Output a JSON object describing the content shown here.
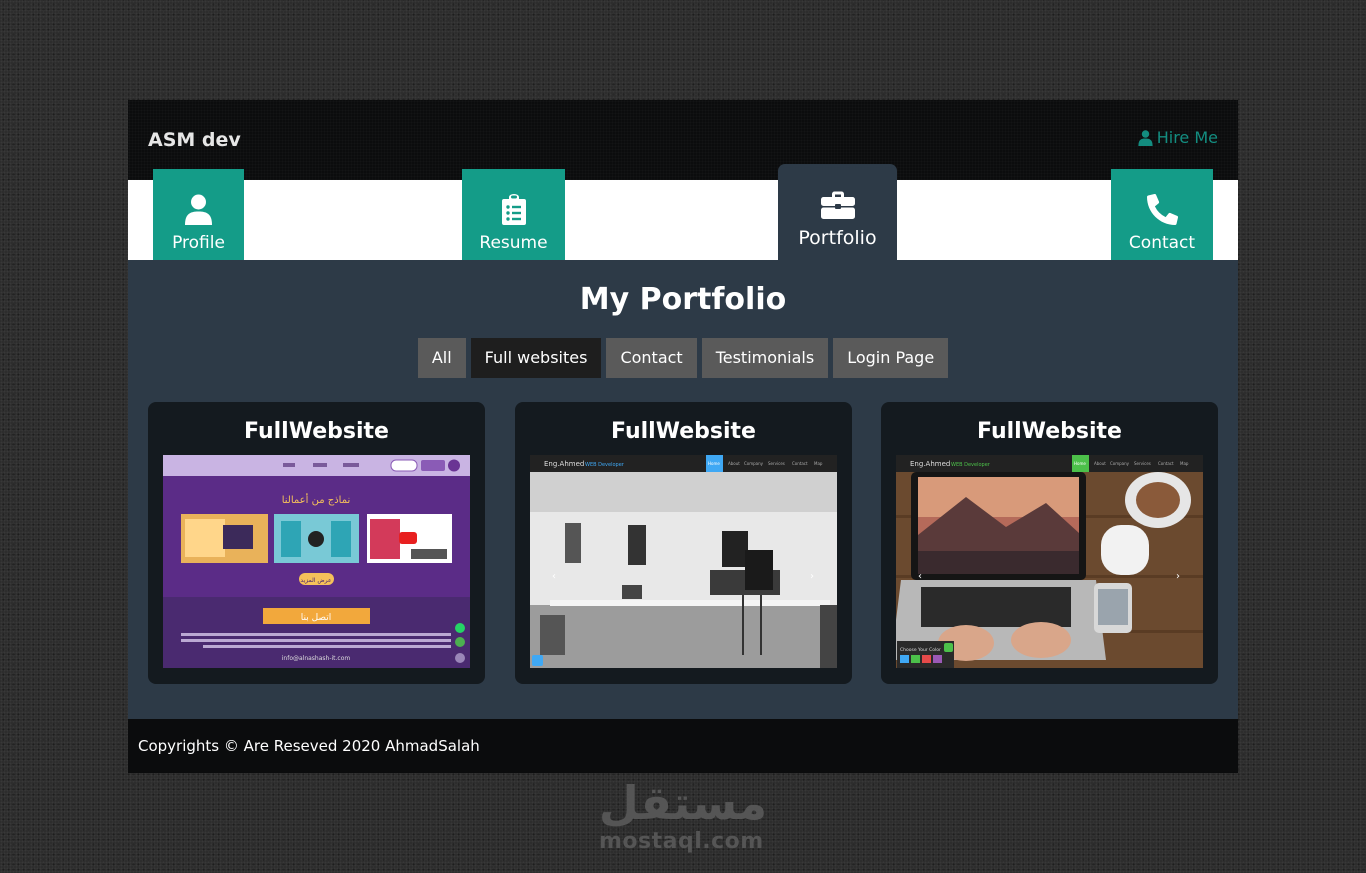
{
  "header": {
    "brand": "ASM dev",
    "hire_label": "Hire Me",
    "hire_icon": "user-icon"
  },
  "nav": [
    {
      "label": "Profile",
      "icon": "user-icon"
    },
    {
      "label": "Resume",
      "icon": "clipboard-list-icon"
    },
    {
      "label": "Portfolio",
      "icon": "briefcase-icon",
      "active": true
    },
    {
      "label": "Contact",
      "icon": "phone-icon"
    }
  ],
  "main": {
    "title": "My Portfolio",
    "filters": [
      "All",
      "Full websites",
      "Contact",
      "Testimonials",
      "Login Page"
    ],
    "active_filter": "Full websites",
    "cards": [
      {
        "title": "FullWebsite",
        "preview": {
          "cta": "اتصل بنا",
          "heading": "نماذج من أعمالنا",
          "more": "عرض المزيد",
          "email": "info@alnashash-it.com"
        }
      },
      {
        "title": "FullWebsite",
        "preview": {
          "brand": "Eng.Ahmed",
          "brand_sub": "WEB Developer",
          "nav": [
            "Home",
            "About",
            "Company",
            "Services",
            "Contact",
            "Map"
          ]
        }
      },
      {
        "title": "FullWebsite",
        "preview": {
          "brand": "Eng.Ahmed",
          "brand_sub": "WEB Developer",
          "nav": [
            "Home",
            "About",
            "Company",
            "Services",
            "Contact",
            "Map"
          ],
          "color_box": "Choose Your Color"
        }
      }
    ]
  },
  "footer": {
    "text": "Copyrights © Are Reseved 2020 AhmadSalah"
  },
  "watermark": {
    "arabic": "مستقل",
    "latin": "mostaql.com"
  },
  "colors": {
    "accent": "#149c88",
    "panel": "#2d3a47",
    "header": "#0b0c0d",
    "card": "#141a1f"
  }
}
